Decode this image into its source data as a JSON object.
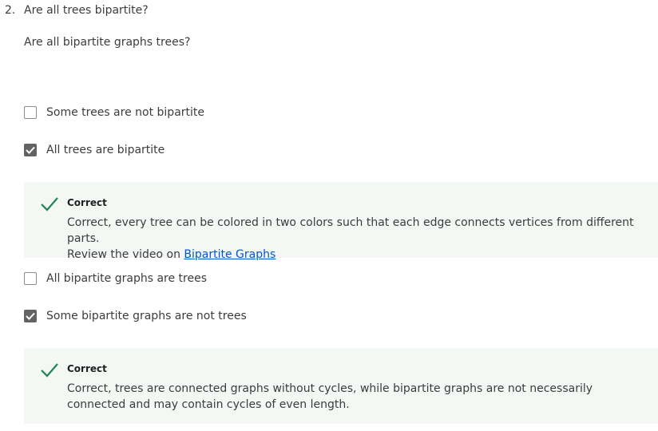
{
  "question": {
    "number": "2.",
    "line1": "Are all trees bipartite?",
    "line2": "Are all bipartite graphs trees?"
  },
  "options": [
    {
      "label": "Some trees are not bipartite",
      "checked": false
    },
    {
      "label": "All trees are bipartite",
      "checked": true
    },
    {
      "label": "All bipartite graphs are trees",
      "checked": false
    },
    {
      "label": "Some bipartite graphs are not trees",
      "checked": true
    }
  ],
  "feedback": [
    {
      "title": "Correct",
      "body_line1": "Correct, every tree can be colored in two colors such that each edge connects vertices from different parts.",
      "body_line2_prefix": "Review the video on ",
      "link_text": "Bipartite Graphs"
    },
    {
      "title": "Correct",
      "body": "Correct, trees are connected graphs without cycles, while bipartite graphs are not necessarily connected and may contain cycles of even length."
    }
  ],
  "colors": {
    "check_green": "#1f8354",
    "feedback_bg": "#f3f8f5",
    "checkbox_checked": "#636363",
    "link": "#0056d2"
  },
  "icons": {
    "correct": "checkmark-icon",
    "checkbox_checked": "checkbox-check-icon"
  }
}
